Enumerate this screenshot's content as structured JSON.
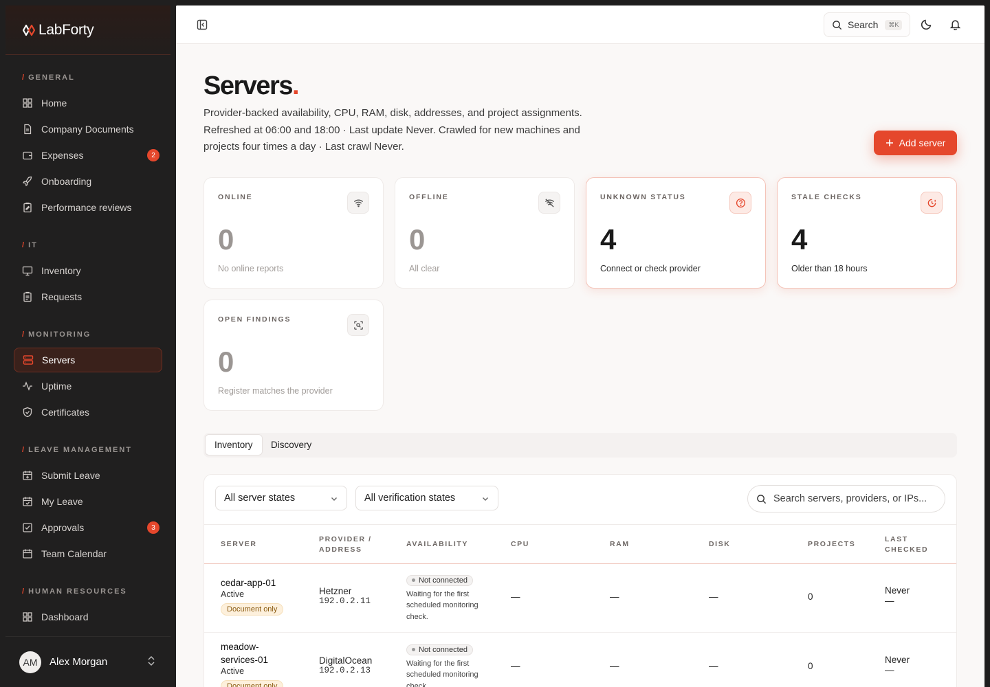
{
  "brand": {
    "name": "LabForty"
  },
  "nav": {
    "groups": [
      {
        "title": "GENERAL",
        "items": [
          {
            "label": "Home",
            "icon": "grid-icon"
          },
          {
            "label": "Company Documents",
            "icon": "document-icon"
          },
          {
            "label": "Expenses",
            "icon": "wallet-icon",
            "badge": "2"
          },
          {
            "label": "Onboarding",
            "icon": "rocket-icon"
          },
          {
            "label": "Performance reviews",
            "icon": "clipboard-edit-icon"
          }
        ]
      },
      {
        "title": "IT",
        "items": [
          {
            "label": "Inventory",
            "icon": "monitor-icon"
          },
          {
            "label": "Requests",
            "icon": "clipboard-list-icon"
          }
        ]
      },
      {
        "title": "MONITORING",
        "items": [
          {
            "label": "Servers",
            "icon": "server-icon",
            "active": true
          },
          {
            "label": "Uptime",
            "icon": "activity-icon"
          },
          {
            "label": "Certificates",
            "icon": "shield-check-icon"
          }
        ]
      },
      {
        "title": "LEAVE MANAGEMENT",
        "items": [
          {
            "label": "Submit Leave",
            "icon": "calendar-plus-icon"
          },
          {
            "label": "My Leave",
            "icon": "calendar-check-icon"
          },
          {
            "label": "Approvals",
            "icon": "check-square-icon",
            "badge": "3"
          },
          {
            "label": "Team Calendar",
            "icon": "calendar-icon"
          }
        ]
      },
      {
        "title": "HUMAN RESOURCES",
        "items": [
          {
            "label": "Dashboard",
            "icon": "grid-icon"
          }
        ]
      }
    ]
  },
  "user": {
    "initials": "AM",
    "name": "Alex Morgan"
  },
  "topbar": {
    "search_label": "Search",
    "search_shortcut": "⌘K"
  },
  "page": {
    "title": "Servers",
    "title_dot": ".",
    "description": "Provider-backed availability, CPU, RAM, disk, addresses, and project assignments. Refreshed at 06:00 and 18:00 · Last update Never. Crawled for new machines and projects four times a day · Last crawl Never.",
    "add_button": "Add server"
  },
  "stats": [
    {
      "label": "ONLINE",
      "value": "0",
      "sub": "No online reports",
      "icon": "wifi-icon",
      "warn": false
    },
    {
      "label": "OFFLINE",
      "value": "0",
      "sub": "All clear",
      "icon": "wifi-off-icon",
      "warn": false
    },
    {
      "label": "UNKNOWN STATUS",
      "value": "4",
      "sub": "Connect or check provider",
      "icon": "help-circle-icon",
      "warn": true
    },
    {
      "label": "STALE CHECKS",
      "value": "4",
      "sub": "Older than 18 hours",
      "icon": "clock-alert-icon",
      "warn": true
    },
    {
      "label": "OPEN FINDINGS",
      "value": "0",
      "sub": "Register matches the provider",
      "icon": "scan-search-icon",
      "warn": false
    }
  ],
  "tabs": {
    "inventory": "Inventory",
    "discovery": "Discovery"
  },
  "filters": {
    "server_states": "All server states",
    "verification_states": "All verification states",
    "search_placeholder": "Search servers, providers, or IPs..."
  },
  "columns": {
    "server": "SERVER",
    "provider_l1": "PROVIDER /",
    "provider_l2": "ADDRESS",
    "availability": "AVAILABILITY",
    "cpu": "CPU",
    "ram": "RAM",
    "disk": "DISK",
    "projects": "PROJECTS",
    "last_l1": "LAST",
    "last_l2": "CHECKED"
  },
  "rows": [
    {
      "name_l1": "cedar-app-01",
      "name_l2": "",
      "state": "Active",
      "tag": "Document only",
      "provider": "Hetzner",
      "ip": "192.0.2.11",
      "availability": "Not connected",
      "availability_note": "Waiting for the first scheduled monitoring check.",
      "cpu": "—",
      "ram": "—",
      "disk": "—",
      "projects": "0",
      "last_checked": "Never",
      "last_sub": "—"
    },
    {
      "name_l1": "meadow-",
      "name_l2": "services-01",
      "state": "Active",
      "tag": "Document only",
      "provider": "DigitalOcean",
      "ip": "192.0.2.13",
      "availability": "Not connected",
      "availability_note": "Waiting for the first scheduled monitoring check.",
      "cpu": "—",
      "ram": "—",
      "disk": "—",
      "projects": "0",
      "last_checked": "Never",
      "last_sub": "—"
    }
  ],
  "colors": {
    "accent": "#e5472c",
    "sidebar_bg": "#201f1f",
    "main_bg": "#faf8f7"
  }
}
